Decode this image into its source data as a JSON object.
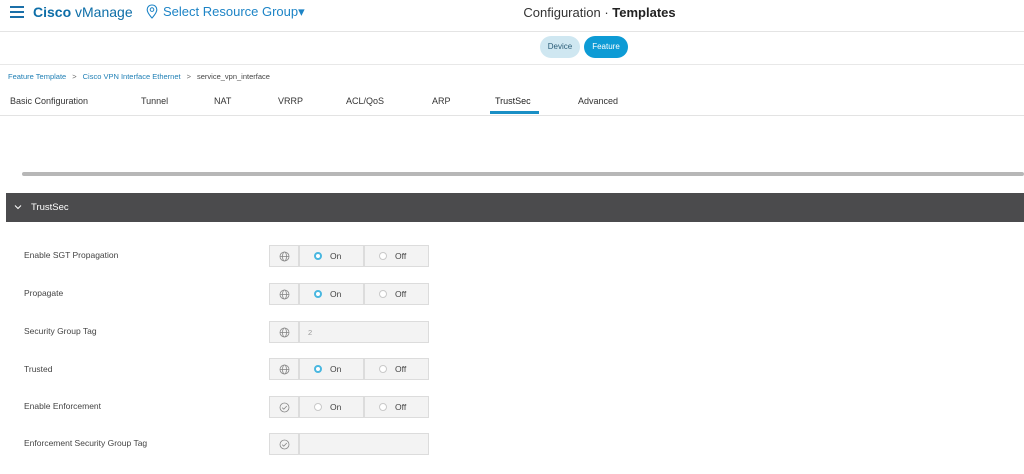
{
  "header": {
    "brand_bold": "Cisco",
    "brand_light": " vManage",
    "resource_group": "Select Resource Group▾",
    "title_light": "Configuration · ",
    "title_bold": "Templates",
    "menu_icon": "hamburger-icon",
    "resource_icon": "location-pin-icon"
  },
  "segment": {
    "device": "Device",
    "feature": "Feature",
    "active": "Feature"
  },
  "breadcrumb": {
    "items": [
      "Feature Template",
      "Cisco VPN Interface Ethernet",
      "service_vpn_interface"
    ],
    "sep": ">"
  },
  "tabs": [
    "Basic Configuration",
    "Tunnel",
    "NAT",
    "VRRP",
    "ACL/QoS",
    "ARP",
    "TrustSec",
    "Advanced"
  ],
  "active_tab": "TrustSec",
  "section": {
    "title": "TrustSec",
    "rows": [
      {
        "label": "Enable SGT Propagation",
        "scope": "global",
        "type": "toggle",
        "on": "On",
        "off": "Off",
        "selected": "on"
      },
      {
        "label": "Propagate",
        "scope": "global",
        "type": "toggle",
        "on": "On",
        "off": "Off",
        "selected": "on"
      },
      {
        "label": "Security Group Tag",
        "scope": "global",
        "type": "text",
        "placeholder": "2"
      },
      {
        "label": "Trusted",
        "scope": "global",
        "type": "toggle",
        "on": "On",
        "off": "Off",
        "selected": "on"
      },
      {
        "label": "Enable Enforcement",
        "scope": "default",
        "type": "toggle",
        "on": "On",
        "off": "Off",
        "selected": "none"
      },
      {
        "label": "Enforcement Security Group Tag",
        "scope": "default",
        "type": "text",
        "placeholder": ""
      }
    ]
  },
  "colors": {
    "brand": "#0d6ea8",
    "accent": "#0d9bd5",
    "section_header": "#4b4b4d",
    "radio_selected": "#49b7e0"
  }
}
